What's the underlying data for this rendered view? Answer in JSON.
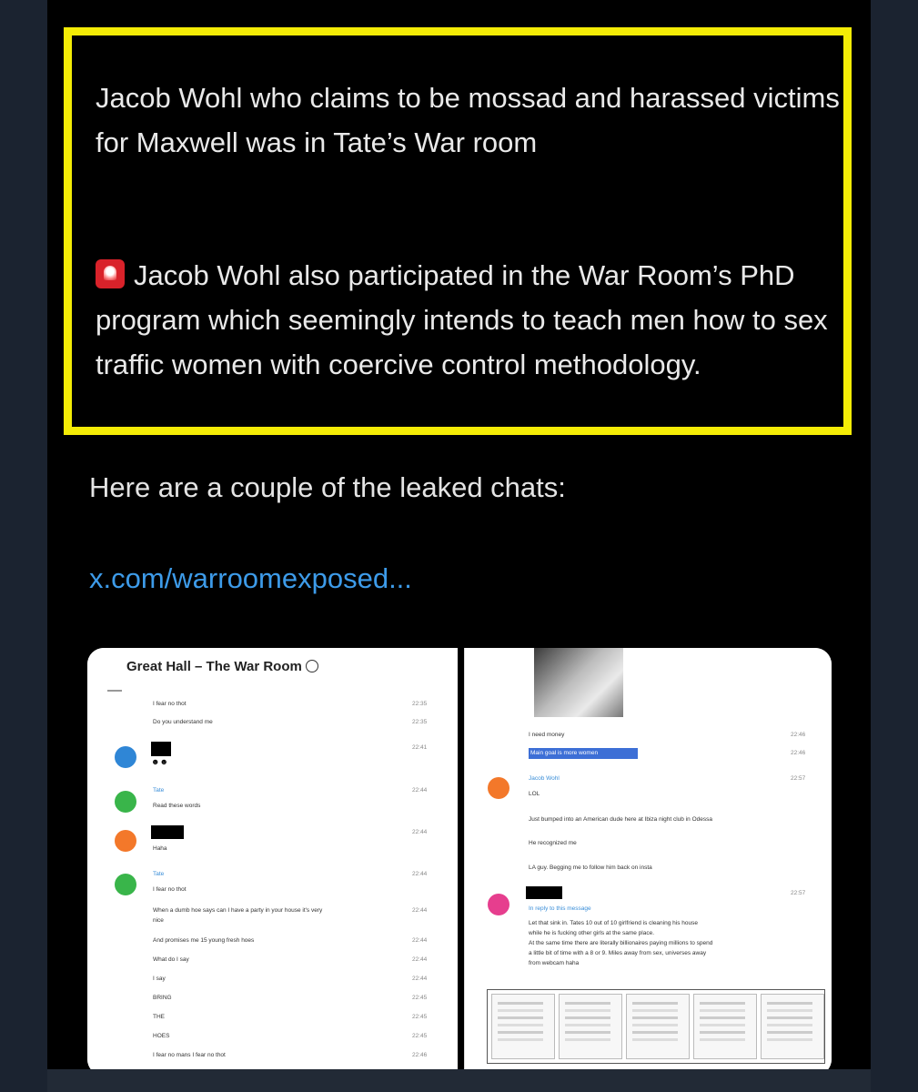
{
  "post": {
    "para1": "Jacob Wohl who claims to be mossad and harassed victims for Maxwell was in Tate’s War room",
    "para2": "Jacob Wohl also participated in the War Room’s PhD program which seemingly intends to teach men how to sex traffic women with coercive control methodology.",
    "lead": "Here are a couple of the leaked chats:",
    "link": "x.com/warroomexposed..."
  },
  "left_chat": {
    "title": "Great Hall – The War Room",
    "lines": [
      {
        "text": "I fear no thot",
        "time": "22:35"
      },
      {
        "text": "Do you understand me",
        "time": "22:35"
      },
      {
        "time": "22:41"
      },
      {
        "name": "Tate",
        "text": "Read these words",
        "time": "22:44"
      },
      {
        "text": "Haha",
        "time": "22:44"
      },
      {
        "name": "Tate",
        "text": "I fear no thot",
        "time": "22:44"
      },
      {
        "text": "When a dumb hoe says can I have a party in your house it's very",
        "text2": "nice",
        "time": "22:44"
      },
      {
        "text": "And promises me 15 young fresh hoes",
        "time": "22:44"
      },
      {
        "text": "What do I say",
        "time": "22:44"
      },
      {
        "text": "I say",
        "time": "22:44"
      },
      {
        "text": "BRING",
        "time": "22:45"
      },
      {
        "text": "THE",
        "time": "22:45"
      },
      {
        "text": "HOES",
        "time": "22:45"
      },
      {
        "text": "I fear no mans I fear no thot",
        "time": "22:46"
      }
    ]
  },
  "right_chat": {
    "lines": [
      {
        "text": "I need money",
        "time": "22:46"
      },
      {
        "text": "Main goal is more women",
        "time": "22:46"
      },
      {
        "name": "Jacob Wohl",
        "text": "LOL",
        "time": "22:57"
      },
      {
        "text": "Just bumped into an American dude here at Ibiza night club in Odessa"
      },
      {
        "text": "He recognized me"
      },
      {
        "text": "LA guy. Begging me to follow him back on insta"
      },
      {
        "reply": "In reply to this message",
        "time": "22:57"
      },
      {
        "text": "Let that sink in. Tates 10 out of 10 girlfriend is cleaning his house"
      },
      {
        "text": "while he is fucking other girls at the same place."
      },
      {
        "text": "At the same time there are literally billionaires paying millions to spend"
      },
      {
        "text": "a little bit of time with a 8 or 9. Miles away from sex, universes away"
      },
      {
        "text": "from webcam haha"
      }
    ]
  },
  "colors": {
    "highlight": "#f4ec06",
    "link": "#3d9be9",
    "avatar_blue": "#2f86d6",
    "avatar_green": "#39b54a",
    "avatar_orange": "#f3782a",
    "avatar_pink": "#e63e8e"
  }
}
